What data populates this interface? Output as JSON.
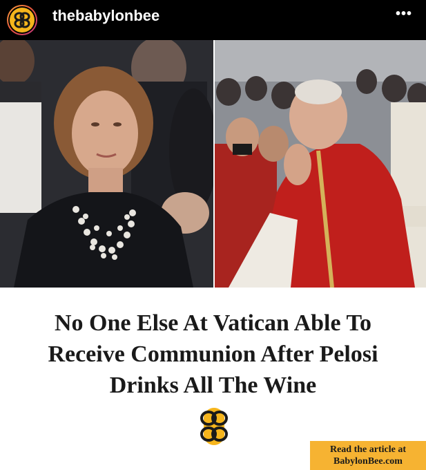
{
  "post": {
    "username": "thebabylonbee",
    "more_label": "•••"
  },
  "image": {
    "headline_lines": [
      "No One Else At Vatican Able To",
      "Receive Communion After Pelosi",
      "Drinks All The Wine"
    ],
    "cta_line1": "Read the article at",
    "cta_line2": "BabylonBee.com"
  },
  "colors": {
    "header_bg": "#000000",
    "brand_yellow": "#f6b51c",
    "cta_bg": "#f6b332",
    "headline": "#1a1a1a"
  },
  "icons": {
    "avatar": "babylon-bee-logo-icon",
    "more": "more-options-icon",
    "logo": "babylon-bee-logo-icon"
  }
}
